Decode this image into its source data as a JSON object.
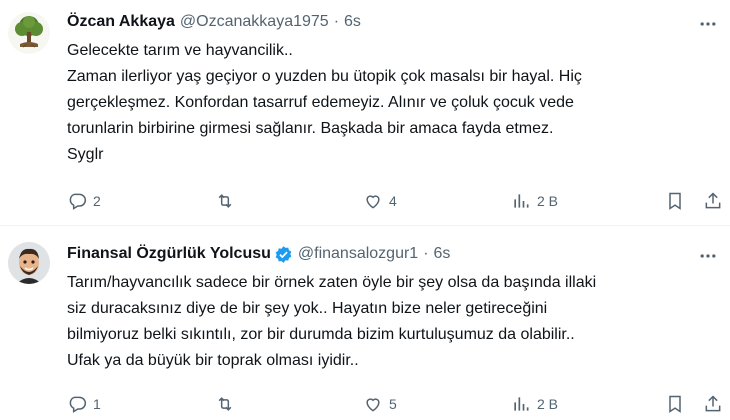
{
  "tweets": [
    {
      "avatar": "tree-avatar-icon",
      "display_name": "Özcan Akkaya",
      "handle": "@Ozcanakkaya1975",
      "separator": "·",
      "time": "6s",
      "verified": false,
      "lines": [
        "Gelecekte tarım ve hayvancilik..",
        "Zaman ilerliyor yaş geçiyor o yuzden bu ütopik çok masalsı bir hayal. Hiç",
        "gerçekleşmez. Konfordan tasarruf edemeyiz. Alınır ve çoluk çocuk vede",
        "torunlarin birbirine girmesi sağlanır. Başkada bir amaca fayda etmez.",
        "Syglr"
      ],
      "replies": "2",
      "retweets": "",
      "likes": "4",
      "views": "2 B"
    },
    {
      "avatar": "memoji-avatar-icon",
      "display_name": "Finansal Özgürlük Yolcusu",
      "handle": "@finansalozgur1",
      "separator": "·",
      "time": "6s",
      "verified": true,
      "lines": [
        "Tarım/hayvancılık sadece bir örnek zaten öyle bir şey olsa da başında illaki",
        "siz duracaksınız diye de bir şey yok.. Hayatın bize neler getireceğini",
        "bilmiyoruz belki sıkıntılı, zor bir durumda bizim kurtuluşumuz da olabilir..",
        "Ufak ya da büyük bir toprak olması iyidir.."
      ],
      "replies": "1",
      "retweets": "",
      "likes": "5",
      "views": "2 B"
    }
  ],
  "colors": {
    "text": "#0f1419",
    "secondary": "#536471",
    "verified_blue": "#1d9bf0",
    "divider": "#eff3f4"
  }
}
